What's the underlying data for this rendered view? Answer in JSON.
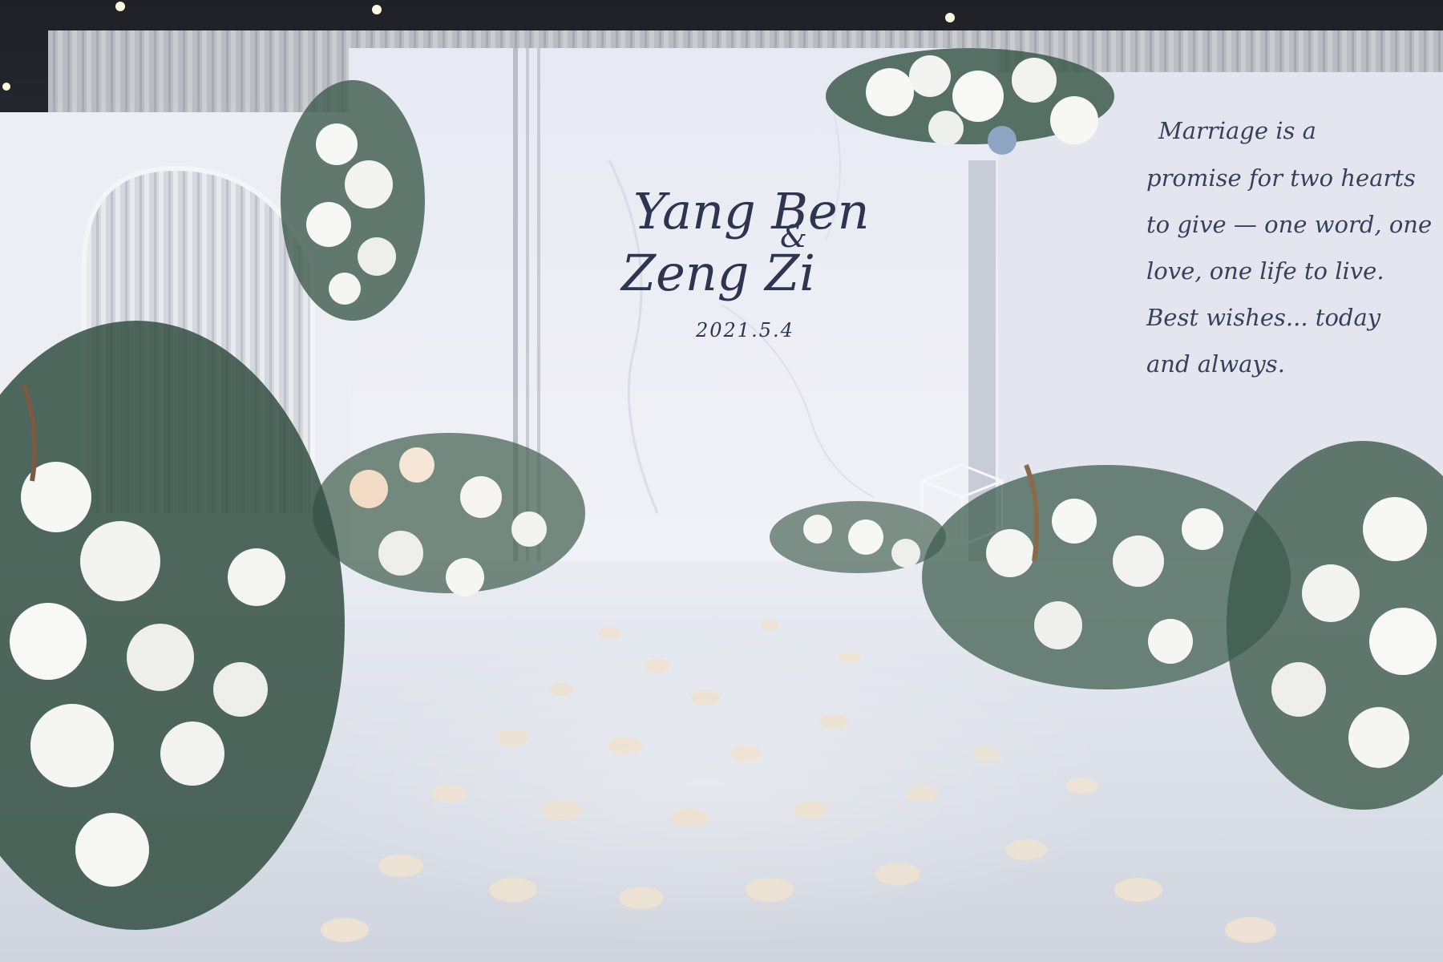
{
  "backdrop": {
    "name_one": "Yang Ben",
    "ampersand": "&",
    "name_two": "Zeng Zi",
    "date": "2021.5.4"
  },
  "quote_panel": {
    "lines": [
      "Marriage is a",
      "promise for two hearts",
      "to give — one word, one",
      "love, one life to live.",
      "Best wishes... today",
      "and always."
    ]
  },
  "colors": {
    "backdrop": "#e9ecf4",
    "ink": "#2f3550",
    "foliage": "#3d5a4b",
    "petal": "#efe3d2",
    "aisle": "#dfe3ec"
  }
}
